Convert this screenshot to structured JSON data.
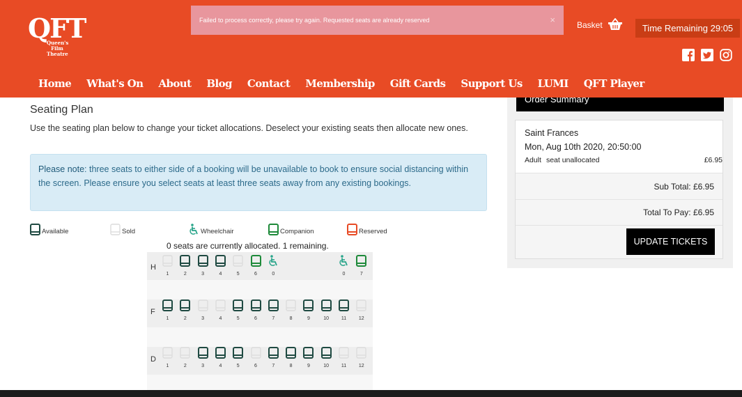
{
  "logo": {
    "mark": "QFT",
    "subtitle": "Queen's Film Theatre"
  },
  "alert": {
    "message": "Failed to process correctly, please try again. Requested seats are already reserved",
    "close": "×"
  },
  "header": {
    "basket_label": "Basket",
    "timer_label": "Time Remaining 29:05"
  },
  "social": [
    {
      "icon": "facebook-icon"
    },
    {
      "icon": "twitter-icon"
    },
    {
      "icon": "instagram-icon"
    }
  ],
  "nav": [
    "Home",
    "What's On",
    "About",
    "Blog",
    "Contact",
    "Membership",
    "Gift Cards",
    "Support Us",
    "LUMI",
    "QFT Player"
  ],
  "main": {
    "title": "Seating Plan",
    "intro": "Use the seating plan below to change your ticket allocations. Deselect your existing seats then allocate new ones.",
    "note_bold": "Please note",
    "note_text": ": three seats to either side of a booking will be unavailable to book to ensure social distancing within the screen. Please ensure you select seats at least three seats away from any existing bookings.",
    "status": "0 seats are currently allocated. 1 remaining."
  },
  "legend": [
    {
      "label": "Available",
      "type": "available"
    },
    {
      "label": "Sold",
      "type": "sold"
    },
    {
      "label": "Wheelchair",
      "type": "wheelchair"
    },
    {
      "label": "Companion",
      "type": "companion"
    },
    {
      "label": "Reserved",
      "type": "reserved"
    }
  ],
  "colors": {
    "brand": "#e84b25",
    "available": "#1f4a42",
    "companion": "#1e8a3a",
    "wheelchair": "#27a489",
    "reserved": "#e84b25",
    "sold": "#dcdcdc"
  },
  "rows": [
    {
      "label": "H",
      "seats": [
        {
          "n": "1",
          "s": "sold"
        },
        {
          "n": "2",
          "s": "available"
        },
        {
          "n": "3",
          "s": "available"
        },
        {
          "n": "4",
          "s": "available"
        },
        {
          "n": "5",
          "s": "sold"
        },
        {
          "n": "6",
          "s": "companion"
        },
        {
          "n": "0",
          "s": "wheelchair"
        },
        {
          "n": "",
          "s": "gap"
        },
        {
          "n": "",
          "s": "gap"
        },
        {
          "n": "",
          "s": "gap"
        },
        {
          "n": "0",
          "s": "wheelchair"
        },
        {
          "n": "7",
          "s": "companion"
        }
      ]
    },
    {
      "label": "F",
      "seats": [
        {
          "n": "1",
          "s": "available"
        },
        {
          "n": "2",
          "s": "available"
        },
        {
          "n": "3",
          "s": "sold"
        },
        {
          "n": "4",
          "s": "sold"
        },
        {
          "n": "5",
          "s": "available"
        },
        {
          "n": "6",
          "s": "available"
        },
        {
          "n": "7",
          "s": "available"
        },
        {
          "n": "8",
          "s": "sold"
        },
        {
          "n": "9",
          "s": "available"
        },
        {
          "n": "10",
          "s": "available"
        },
        {
          "n": "11",
          "s": "available"
        },
        {
          "n": "12",
          "s": "sold"
        }
      ]
    },
    {
      "label": "D",
      "seats": [
        {
          "n": "1",
          "s": "sold"
        },
        {
          "n": "2",
          "s": "sold"
        },
        {
          "n": "3",
          "s": "available"
        },
        {
          "n": "4",
          "s": "available"
        },
        {
          "n": "5",
          "s": "available"
        },
        {
          "n": "6",
          "s": "sold"
        },
        {
          "n": "7",
          "s": "available"
        },
        {
          "n": "8",
          "s": "available"
        },
        {
          "n": "9",
          "s": "available"
        },
        {
          "n": "10",
          "s": "available"
        },
        {
          "n": "11",
          "s": "sold"
        },
        {
          "n": "12",
          "s": "sold"
        }
      ]
    }
  ],
  "summary": {
    "heading": "Order Summary",
    "film": "Saint Frances",
    "showtime": "Mon, Aug 10th 2020, 20:50:00",
    "ticket_type": "Adult",
    "ticket_seat": "seat unallocated",
    "ticket_price": "£6.95",
    "subtotal": "Sub Total: £6.95",
    "total": "Total To Pay: £6.95",
    "button": "UPDATE TICKETS"
  }
}
